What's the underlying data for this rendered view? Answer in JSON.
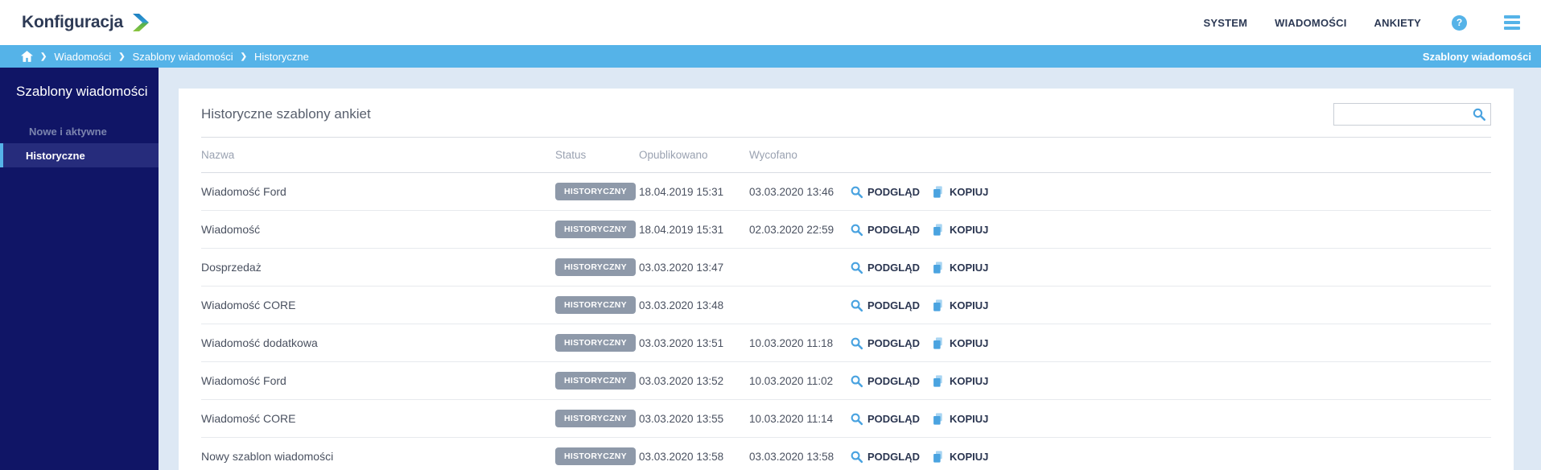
{
  "header": {
    "logo_text": "Konfiguracja",
    "nav": [
      {
        "label": "SYSTEM",
        "active": false
      },
      {
        "label": "WIADOMOŚCI",
        "active": true
      },
      {
        "label": "ANKIETY",
        "active": false
      }
    ],
    "icons": [
      "question-help-icon",
      "hamburger-menu-icon"
    ]
  },
  "breadcrumb": {
    "home_icon": "home-icon",
    "items": [
      "Wiadomości",
      "Szablony wiadomości",
      "Historyczne"
    ],
    "right_label": "Szablony wiadomości"
  },
  "sidebar": {
    "title": "Szablony wiadomości",
    "items": [
      {
        "label": "Nowe i aktywne",
        "active": false
      },
      {
        "label": "Historyczne",
        "active": true
      }
    ]
  },
  "main": {
    "title": "Historyczne szablony ankiet",
    "search": {
      "value": "",
      "placeholder": "",
      "icon": "search-icon"
    },
    "table": {
      "columns": [
        "Nazwa",
        "Status",
        "Opublikowano",
        "Wycofano"
      ],
      "actions": {
        "preview": "PODGLĄD",
        "copy": "KOPIUJ"
      },
      "rows": [
        {
          "name": "Wiadomość Ford",
          "status": "HISTORYCZNY",
          "published": "18.04.2019 15:31",
          "withdrawn": "03.03.2020 13:46"
        },
        {
          "name": "Wiadomość",
          "status": "HISTORYCZNY",
          "published": "18.04.2019 15:31",
          "withdrawn": "02.03.2020 22:59"
        },
        {
          "name": "Dosprzedaż",
          "status": "HISTORYCZNY",
          "published": "03.03.2020 13:47",
          "withdrawn": ""
        },
        {
          "name": "Wiadomość CORE",
          "status": "HISTORYCZNY",
          "published": "03.03.2020 13:48",
          "withdrawn": ""
        },
        {
          "name": "Wiadomość dodatkowa",
          "status": "HISTORYCZNY",
          "published": "03.03.2020 13:51",
          "withdrawn": "10.03.2020 11:18"
        },
        {
          "name": "Wiadomość Ford",
          "status": "HISTORYCZNY",
          "published": "03.03.2020 13:52",
          "withdrawn": "10.03.2020 11:02"
        },
        {
          "name": "Wiadomość CORE",
          "status": "HISTORYCZNY",
          "published": "03.03.2020 13:55",
          "withdrawn": "10.03.2020 11:14"
        },
        {
          "name": "Nowy szablon wiadomości",
          "status": "HISTORYCZNY",
          "published": "03.03.2020 13:58",
          "withdrawn": "03.03.2020 13:58"
        }
      ]
    }
  },
  "colors": {
    "accent_blue": "#55b3e8",
    "sidebar_navy": "#101566",
    "sidebar_active": "#262c7c",
    "badge_gray": "#8e99a9",
    "nav_text": "#2d3a55",
    "page_background": "#dde8f4",
    "logo_green": "#8dc63f",
    "logo_blue": "#1e7fc0"
  }
}
